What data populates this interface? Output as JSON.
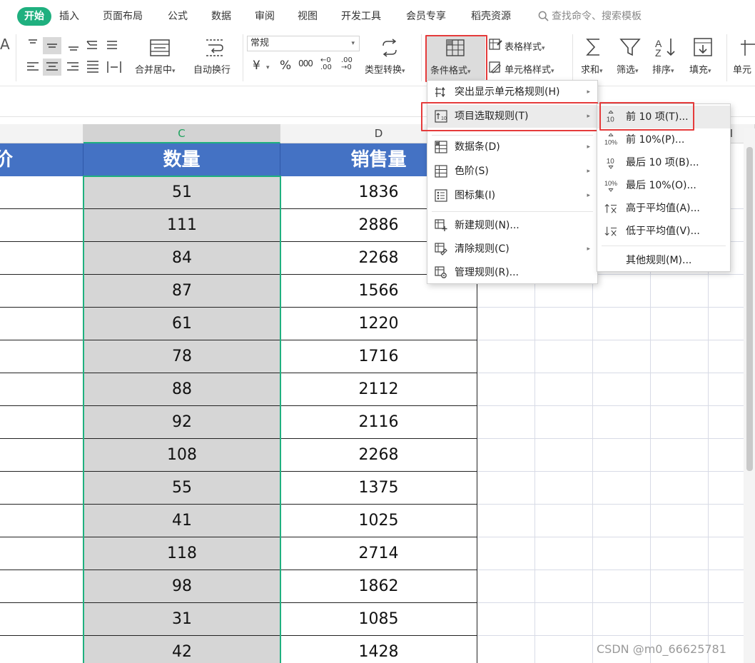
{
  "tabs": {
    "active": "开始",
    "items": [
      "插入",
      "页面布局",
      "公式",
      "数据",
      "审阅",
      "视图",
      "开发工具",
      "会员专享",
      "稻壳资源"
    ],
    "search_placeholder": "查找命令、搜索模板"
  },
  "ribbon": {
    "merge_center": "合并居中",
    "wrap_text": "自动换行",
    "number_format": "常规",
    "currency": "¥",
    "percent": "%",
    "thousands": "000",
    "inc_decimal": "←0 .00",
    "dec_decimal": ".00 →0",
    "type_convert": "类型转换",
    "conditional_format": "条件格式",
    "table_style": "表格样式",
    "cell_style": "单元格样式",
    "sum": "求和",
    "filter": "筛选",
    "sort": "排序",
    "fill": "填充",
    "cell_partial": "单元",
    "font_partial": "A"
  },
  "grid": {
    "col_c": "C",
    "col_d": "D",
    "col_i": "I",
    "header_b_partial": "价",
    "header_c": "数量",
    "header_d": "销售量",
    "rows": [
      {
        "qty": "51",
        "sales": "1836"
      },
      {
        "qty": "111",
        "sales": "2886"
      },
      {
        "qty": "84",
        "sales": "2268"
      },
      {
        "qty": "87",
        "sales": "1566"
      },
      {
        "qty": "61",
        "sales": "1220"
      },
      {
        "qty": "78",
        "sales": "1716"
      },
      {
        "qty": "88",
        "sales": "2112"
      },
      {
        "qty": "92",
        "sales": "2116"
      },
      {
        "qty": "108",
        "sales": "2268"
      },
      {
        "qty": "55",
        "sales": "1375"
      },
      {
        "qty": "41",
        "sales": "1025"
      },
      {
        "qty": "118",
        "sales": "2714"
      },
      {
        "qty": "98",
        "sales": "1862"
      },
      {
        "qty": "31",
        "sales": "1085"
      },
      {
        "qty": "42",
        "sales": "1428"
      }
    ]
  },
  "cf_menu": {
    "highlight_rules": "突出显示单元格规则(H)",
    "top_bottom_rules": "项目选取规则(T)",
    "data_bars": "数据条(D)",
    "color_scales": "色阶(S)",
    "icon_sets": "图标集(I)",
    "new_rule": "新建规则(N)...",
    "clear_rules": "清除规则(C)",
    "manage_rules": "管理规则(R)..."
  },
  "sub_menu": {
    "top10": "前 10 项(T)...",
    "top10pct": "前 10%(P)...",
    "bottom10": "最后 10 项(B)...",
    "bottom10pct": "最后 10%(O)...",
    "above_avg": "高于平均值(A)...",
    "below_avg": "低于平均值(V)...",
    "more_rules": "其他规则(M)..."
  },
  "watermark": "CSDN @m0_66625781",
  "colors": {
    "accent_green": "#1fb07f",
    "header_blue": "#4472c4",
    "highlight_red": "#e53b3b",
    "selection_gray": "#d6d6d6"
  }
}
